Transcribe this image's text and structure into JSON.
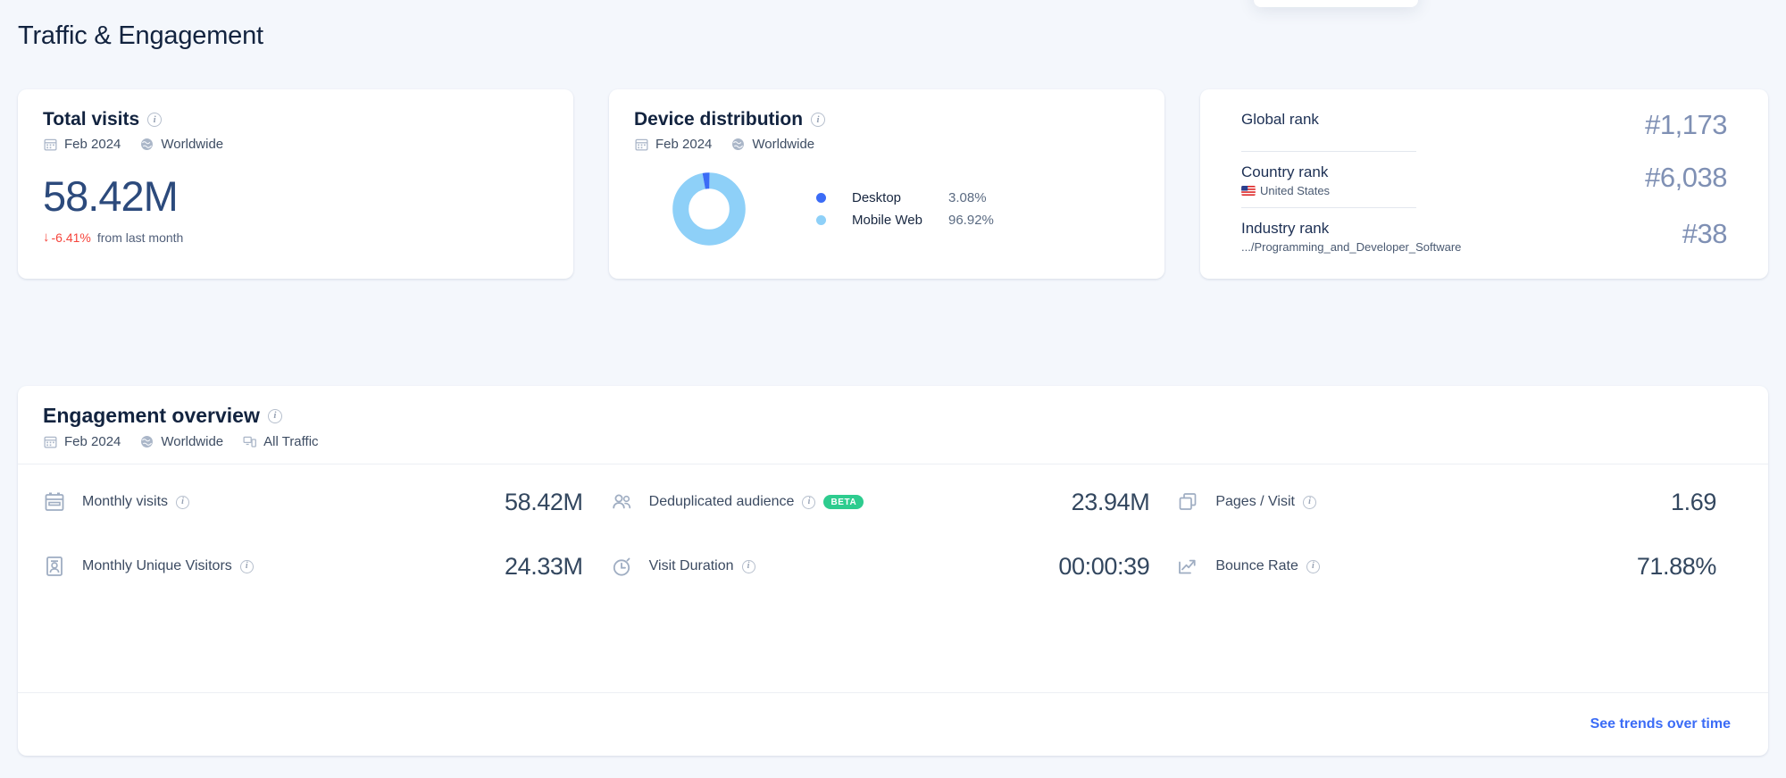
{
  "page": {
    "title": "Traffic & Engagement"
  },
  "colors": {
    "accent_link": "#3b6cf6",
    "desktop": "#3b6cf6",
    "mobile_web": "#8ed0f8",
    "negative": "#f6453c",
    "beta_badge": "#2ecc8f",
    "background": "#f4f7fc",
    "card": "#ffffff"
  },
  "total_visits": {
    "title": "Total visits",
    "info_icon": "info-icon",
    "date_icon": "calendar-icon",
    "date": "Feb 2024",
    "geo_icon": "globe-icon",
    "geo": "Worldwide",
    "value": "58.42M",
    "delta_arrow": "↓",
    "delta": "-6.41%",
    "delta_suffix": "from last month"
  },
  "device_distribution": {
    "title": "Device distribution",
    "info_icon": "info-icon",
    "date_icon": "calendar-icon",
    "date": "Feb 2024",
    "geo_icon": "globe-icon",
    "geo": "Worldwide",
    "legend": [
      {
        "label": "Desktop",
        "value": "3.08%",
        "color": "#3b6cf6"
      },
      {
        "label": "Mobile Web",
        "value": "96.92%",
        "color": "#8ed0f8"
      }
    ]
  },
  "ranks": [
    {
      "name": "Global rank",
      "sub": "",
      "sub_icon": "",
      "value": "#1,173"
    },
    {
      "name": "Country rank",
      "sub": "United States",
      "sub_icon": "us-flag-icon",
      "value": "#6,038"
    },
    {
      "name": "Industry rank",
      "sub": ".../Programming_and_Developer_Software",
      "sub_icon": "",
      "value": "#38"
    }
  ],
  "engagement": {
    "title": "Engagement overview",
    "info_icon": "info-icon",
    "date_icon": "calendar-icon",
    "date": "Feb 2024",
    "geo_icon": "globe-icon",
    "geo": "Worldwide",
    "traffic_icon": "devices-icon",
    "traffic": "All Traffic",
    "metrics": [
      {
        "icon": "calendar-visits-icon",
        "label": "Monthly visits",
        "info_icon": "info-icon",
        "badge": "",
        "value": "58.42M"
      },
      {
        "icon": "people-icon",
        "label": "Deduplicated audience",
        "info_icon": "info-icon",
        "badge": "BETA",
        "value": "23.94M"
      },
      {
        "icon": "pages-icon",
        "label": "Pages / Visit",
        "info_icon": "info-icon",
        "badge": "",
        "value": "1.69"
      },
      {
        "icon": "id-card-icon",
        "label": "Monthly Unique Visitors",
        "info_icon": "info-icon",
        "badge": "",
        "value": "24.33M"
      },
      {
        "icon": "stopwatch-icon",
        "label": "Visit Duration",
        "info_icon": "info-icon",
        "badge": "",
        "value": "00:00:39"
      },
      {
        "icon": "trend-up-icon",
        "label": "Bounce Rate",
        "info_icon": "info-icon",
        "badge": "",
        "value": "71.88%"
      }
    ],
    "footer_link": "See trends over time"
  },
  "chart_data": {
    "type": "pie",
    "title": "Device distribution",
    "categories": [
      "Desktop",
      "Mobile Web"
    ],
    "values": [
      3.08,
      96.92
    ],
    "unit": "%",
    "colors": [
      "#3b6cf6",
      "#8ed0f8"
    ],
    "legend_position": "right",
    "donut": true
  }
}
